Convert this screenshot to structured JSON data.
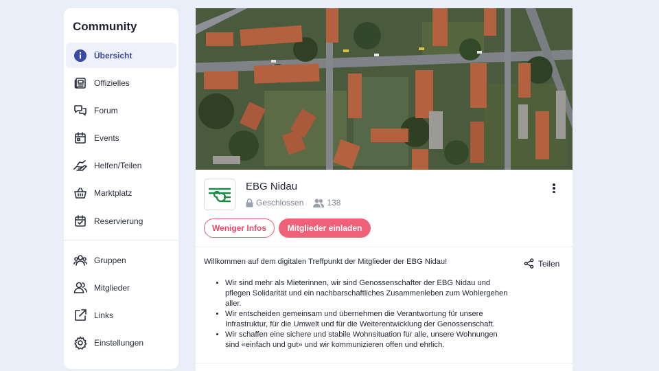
{
  "sidebar": {
    "title": "Community",
    "items": [
      {
        "label": "Übersicht",
        "icon": "info-icon"
      },
      {
        "label": "Offizielles",
        "icon": "newspaper-icon"
      },
      {
        "label": "Forum",
        "icon": "chat-bubbles-icon"
      },
      {
        "label": "Events",
        "icon": "calendar-icon"
      },
      {
        "label": "Helfen/Teilen",
        "icon": "helping-hand-icon"
      },
      {
        "label": "Marktplatz",
        "icon": "basket-icon"
      },
      {
        "label": "Reservierung",
        "icon": "calendar-check-icon"
      }
    ],
    "items2": [
      {
        "label": "Gruppen",
        "icon": "groups-icon"
      },
      {
        "label": "Mitglieder",
        "icon": "members-icon"
      },
      {
        "label": "Links",
        "icon": "external-link-icon"
      },
      {
        "label": "Einstellungen",
        "icon": "gear-icon"
      }
    ]
  },
  "group": {
    "name": "EBG Nidau",
    "privacy": "Geschlossen",
    "member_count": "138",
    "less_info_label": "Weniger Infos",
    "invite_label": "Mitglieder einladen",
    "share_label": "Teilen"
  },
  "description": {
    "intro": "Willkommen auf dem digitalen Treffpunkt der Mitglieder der EBG Nidau!",
    "bullets": [
      "Wir sind mehr als Mieterinnen, wir sind Genossenschafter der EBG Nidau und pflegen Solidarität und ein nachbarschaftliches Zusammenleben zum Wohlergehen aller.",
      "Wir entscheiden gemeinsam und übernehmen die Verantwortung für unsere Infrastruktur, für die Umwelt und für die Weiterentwicklung der Genossenschaft.",
      "Wir schaffen eine sichere und stabile Wohnsituation für alle, unsere Wohnungen sind «einfach und gut» und wir kommunizieren offen und ehrlich."
    ]
  },
  "colors": {
    "accent": "#ef6079",
    "active_nav": "#3a4aa5",
    "background": "#e9eef8"
  }
}
